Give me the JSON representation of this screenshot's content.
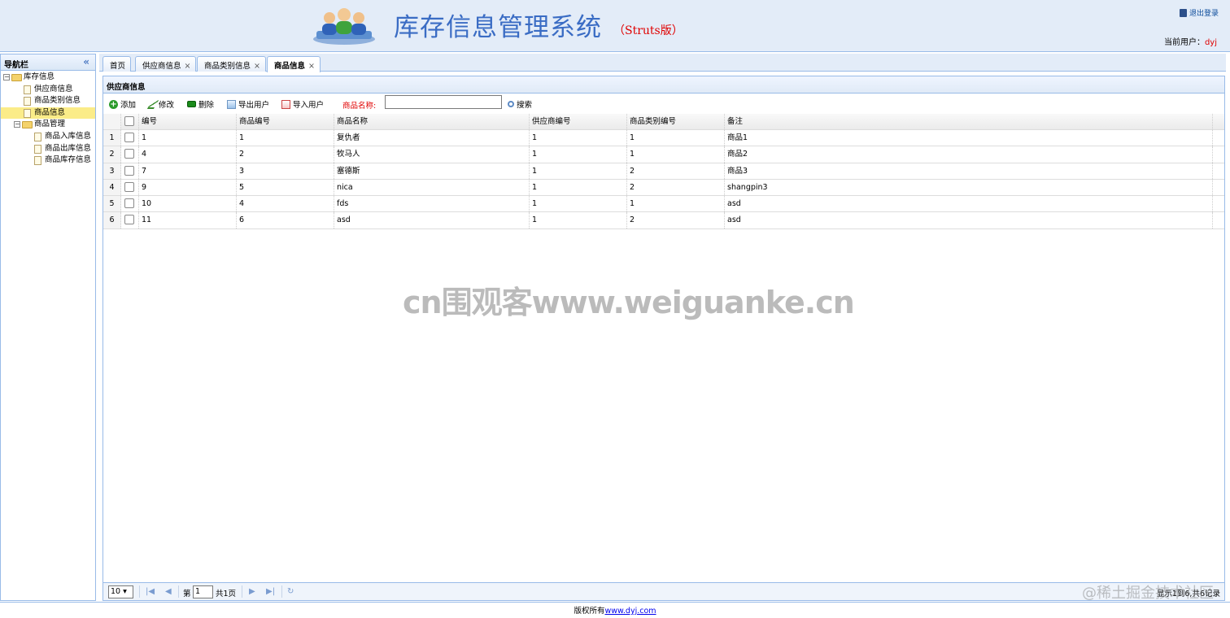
{
  "header": {
    "title": "库存信息管理系统",
    "subtitle": "（Struts版）",
    "logout_label": "退出登录",
    "current_user_label": "当前用户：",
    "current_user": "dyj"
  },
  "nav": {
    "title": "导航栏",
    "groups": [
      {
        "label": "库存信息",
        "items": [
          {
            "label": "供应商信息"
          },
          {
            "label": "商品类别信息"
          },
          {
            "label": "商品信息"
          }
        ]
      },
      {
        "label": "商品管理",
        "items": [
          {
            "label": "商品入库信息"
          },
          {
            "label": "商品出库信息"
          },
          {
            "label": "商品库存信息"
          }
        ]
      }
    ],
    "selected": "商品信息"
  },
  "tabs": [
    {
      "label": "首页",
      "closable": false
    },
    {
      "label": "供应商信息",
      "closable": true
    },
    {
      "label": "商品类别信息",
      "closable": true
    },
    {
      "label": "商品信息",
      "closable": true,
      "active": true
    }
  ],
  "panel": {
    "title": "供应商信息",
    "toolbar": {
      "add": "添加",
      "edit": "修改",
      "delete": "删除",
      "export": "导出用户",
      "import": "导入用户",
      "search_label": "商品名称:",
      "search_value": "",
      "search_button": "搜索"
    },
    "columns": [
      "编号",
      "商品编号",
      "商品名称",
      "供应商编号",
      "商品类别编号",
      "备注"
    ],
    "rows": [
      {
        "num": "1",
        "cells": [
          "1",
          "1",
          "复仇者",
          "1",
          "1",
          "商品1"
        ]
      },
      {
        "num": "2",
        "cells": [
          "4",
          "2",
          "牧马人",
          "1",
          "1",
          "商品2"
        ]
      },
      {
        "num": "3",
        "cells": [
          "7",
          "3",
          "塞德斯",
          "1",
          "2",
          "商品3"
        ]
      },
      {
        "num": "4",
        "cells": [
          "9",
          "5",
          "nica",
          "1",
          "2",
          "shangpin3"
        ]
      },
      {
        "num": "5",
        "cells": [
          "10",
          "4",
          "fds",
          "1",
          "1",
          "asd"
        ]
      },
      {
        "num": "6",
        "cells": [
          "11",
          "6",
          "asd",
          "1",
          "2",
          "asd"
        ]
      }
    ],
    "pager": {
      "page_size": "10",
      "page_prefix": "第",
      "page_value": "1",
      "page_total": "共1页",
      "info": "显示1到6,共6记录"
    }
  },
  "footer": {
    "text": "版权所有",
    "link": "www.dyj.com"
  },
  "watermarks": {
    "center": "cn围观客www.weiguanke.cn",
    "corner": "@稀土掘金技术社区"
  }
}
